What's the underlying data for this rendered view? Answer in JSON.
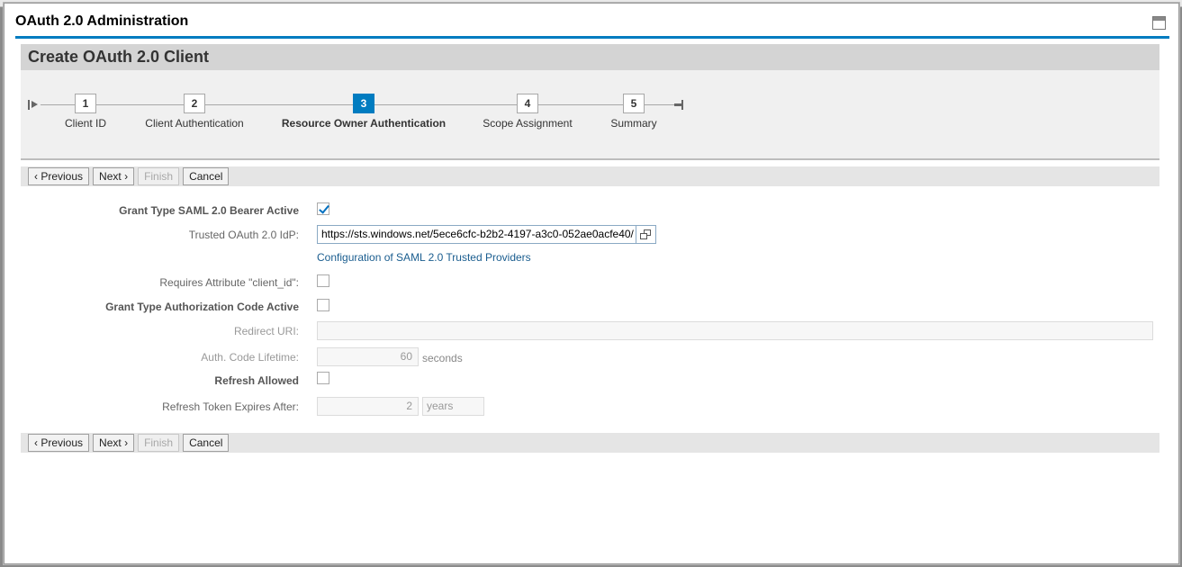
{
  "dialog": {
    "title": "OAuth 2.0 Administration",
    "maximize_icon": "maximize-icon"
  },
  "wizard": {
    "title": "Create OAuth 2.0 Client",
    "steps": [
      {
        "number": "1",
        "label": "Client ID",
        "active": false
      },
      {
        "number": "2",
        "label": "Client Authentication",
        "active": false
      },
      {
        "number": "3",
        "label": "Resource Owner Authentication",
        "active": true
      },
      {
        "number": "4",
        "label": "Scope Assignment",
        "active": false
      },
      {
        "number": "5",
        "label": "Summary",
        "active": false
      }
    ],
    "accent_color": "#007cc0"
  },
  "buttons": {
    "previous": "Previous",
    "next": "Next",
    "finish": "Finish",
    "cancel": "Cancel"
  },
  "form": {
    "saml_bearer": {
      "label": "Grant Type SAML 2.0 Bearer Active",
      "checked": true
    },
    "trusted_idp": {
      "label": "Trusted OAuth 2.0 IdP:",
      "value": "https://sts.windows.net/5ece6cfc-b2b2-4197-a3c0-052ae0acfe40/"
    },
    "saml_providers_link": "Configuration of SAML 2.0 Trusted Providers",
    "requires_client_id": {
      "label": "Requires Attribute \"client_id\":",
      "checked": false
    },
    "auth_code_active": {
      "label": "Grant Type Authorization Code Active",
      "checked": false
    },
    "redirect_uri": {
      "label": "Redirect URI:",
      "value": ""
    },
    "auth_code_lifetime": {
      "label": "Auth. Code Lifetime:",
      "value": "60",
      "unit": "seconds"
    },
    "refresh_allowed": {
      "label": "Refresh Allowed",
      "checked": false
    },
    "refresh_expires": {
      "label": "Refresh Token Expires After:",
      "value": "2",
      "unit": "years"
    }
  }
}
